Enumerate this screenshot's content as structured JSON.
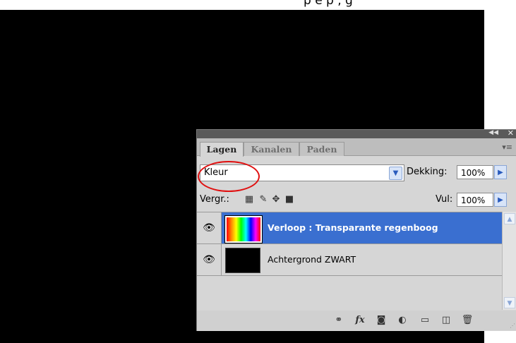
{
  "top_text": "p   e   p    ,    g",
  "panel": {
    "tabs": [
      {
        "label": "Lagen",
        "active": true
      },
      {
        "label": "Kanalen",
        "active": false
      },
      {
        "label": "Paden",
        "active": false
      }
    ],
    "blend_mode": "Kleur",
    "opacity_label": "Dekking:",
    "opacity_value": "100%",
    "lock_label": "Vergr.:",
    "fill_label": "Vul:",
    "fill_value": "100%",
    "layers": [
      {
        "name": "Verloop : Transparante regenboog",
        "selected": true,
        "visible": true,
        "thumb": "rainbow"
      },
      {
        "name": "Achtergrond ZWART",
        "selected": false,
        "visible": true,
        "thumb": "black"
      }
    ],
    "icons": {
      "lock": [
        "lock-transparent-icon",
        "lock-brush-icon",
        "lock-move-icon",
        "lock-all-icon"
      ],
      "bottom": [
        "link-layers-icon",
        "fx-icon",
        "add-mask-icon",
        "adjustment-layer-icon",
        "new-group-icon",
        "new-layer-icon",
        "trash-icon"
      ]
    },
    "colors": {
      "selected_row": "#3a6fd0",
      "annotation_circle": "#e01010"
    }
  }
}
